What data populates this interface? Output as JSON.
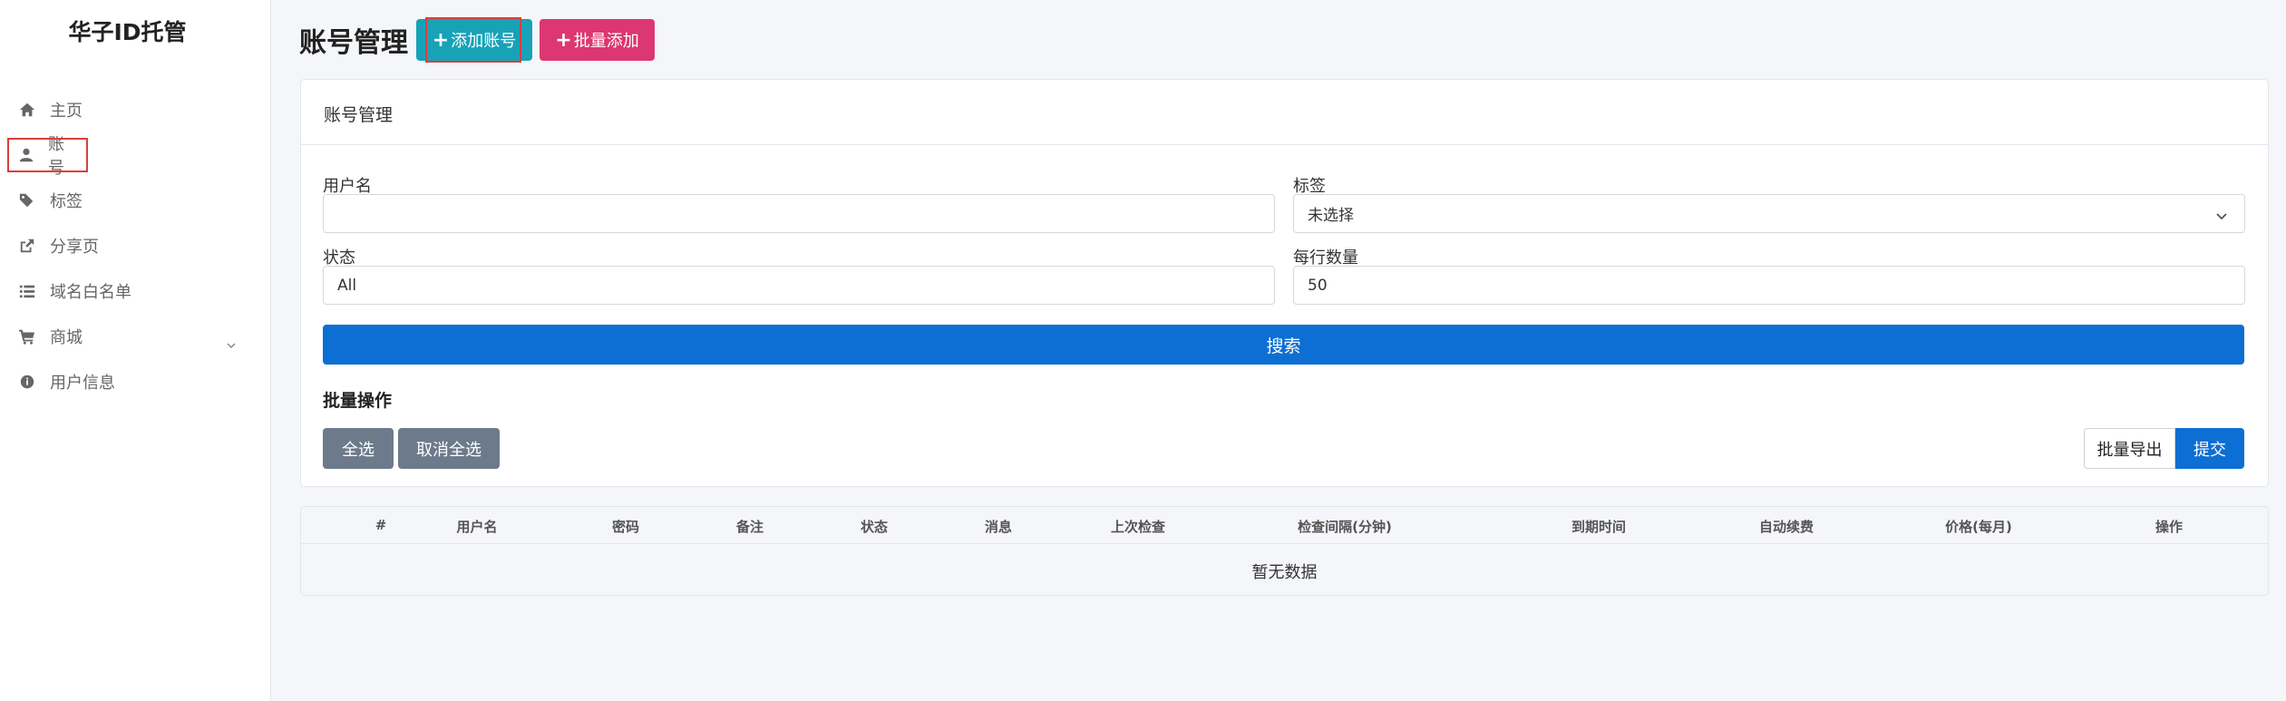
{
  "sidebar": {
    "brand": "华子ID托管",
    "items": [
      {
        "label": "主页",
        "icon": "home-icon"
      },
      {
        "label": "账号",
        "icon": "user-icon"
      },
      {
        "label": "标签",
        "icon": "tags-icon"
      },
      {
        "label": "分享页",
        "icon": "share-icon"
      },
      {
        "label": "域名白名单",
        "icon": "list-icon"
      },
      {
        "label": "商城",
        "icon": "cart-icon"
      },
      {
        "label": "用户信息",
        "icon": "info-icon"
      }
    ]
  },
  "header": {
    "title": "账号管理",
    "add_label": "添加账号",
    "batch_add_label": "批量添加"
  },
  "card": {
    "title": "账号管理",
    "username_label": "用户名",
    "username_value": "",
    "tag_label": "标签",
    "tag_value": "未选择",
    "status_label": "状态",
    "status_value": "All",
    "per_page_label": "每行数量",
    "per_page_value": "50",
    "search_label": "搜索",
    "batch_title": "批量操作",
    "select_all": "全选",
    "deselect_all": "取消全选",
    "export_label": "批量导出",
    "submit_label": "提交"
  },
  "table": {
    "columns": [
      "#",
      "用户名",
      "密码",
      "备注",
      "状态",
      "消息",
      "上次检查",
      "检查间隔(分钟)",
      "到期时间",
      "自动续费",
      "价格(每月)",
      "操作"
    ],
    "empty_text": "暂无数据"
  },
  "colors": {
    "primary": "#0d6fd3",
    "info": "#17a2b8",
    "pink": "#dc3770",
    "secondary": "#6c7a8b",
    "highlight": "#d9403a"
  }
}
